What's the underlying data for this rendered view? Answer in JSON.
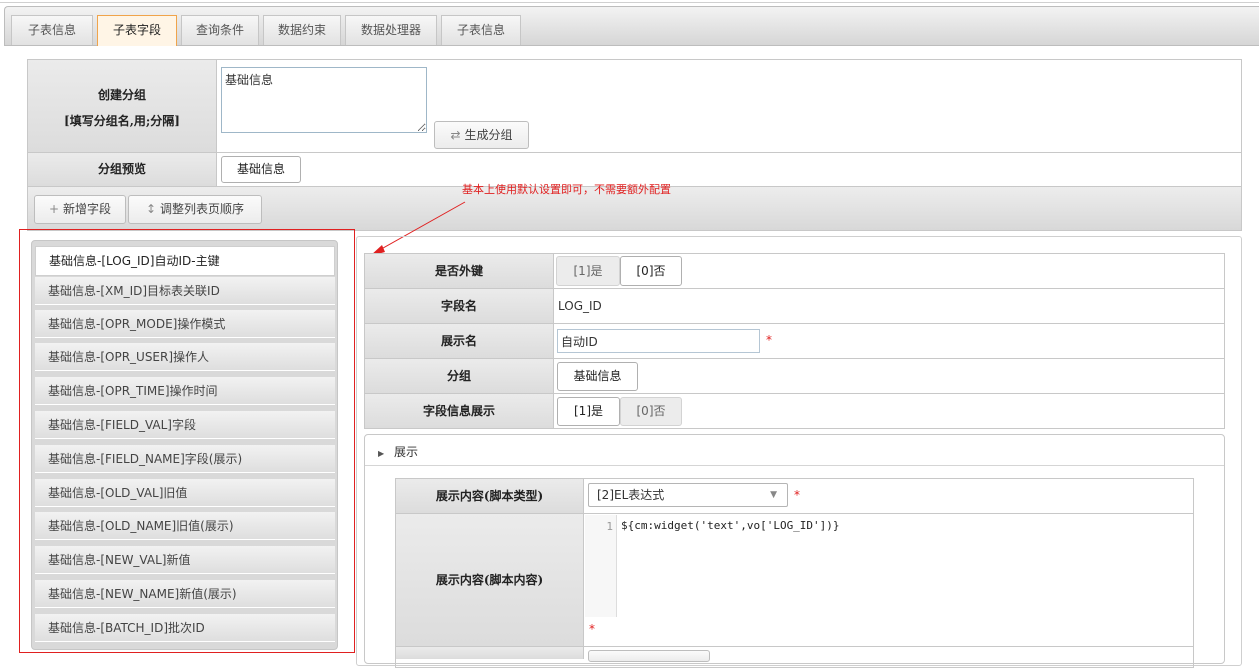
{
  "tabs": [
    {
      "label": "子表信息"
    },
    {
      "label": "子表字段"
    },
    {
      "label": "查询条件"
    },
    {
      "label": "数据约束"
    },
    {
      "label": "数据处理器"
    },
    {
      "label": "子表信息"
    }
  ],
  "group_form": {
    "create_label_line1": "创建分组",
    "create_label_line2": "[填写分组名,用;分隔]",
    "textarea_value": "基础信息",
    "generate_button": "生成分组",
    "preview_label": "分组预览",
    "preview_chip": "基础信息"
  },
  "toolbar": {
    "add_field": "新增字段",
    "reorder": "调整列表页顺序"
  },
  "annotation": "基本上使用默认设置即可，不需要额外配置",
  "field_list": [
    "基础信息-[LOG_ID]自动ID-主键",
    "基础信息-[XM_ID]目标表关联ID",
    "基础信息-[OPR_MODE]操作模式",
    "基础信息-[OPR_USER]操作人",
    "基础信息-[OPR_TIME]操作时间",
    "基础信息-[FIELD_VAL]字段",
    "基础信息-[FIELD_NAME]字段(展示)",
    "基础信息-[OLD_VAL]旧值",
    "基础信息-[OLD_NAME]旧值(展示)",
    "基础信息-[NEW_VAL]新值",
    "基础信息-[NEW_NAME]新值(展示)",
    "基础信息-[BATCH_ID]批次ID"
  ],
  "detail": {
    "foreign_key_label": "是否外键",
    "yes_label": "[1]是",
    "no_label": "[0]否",
    "field_name_label": "字段名",
    "field_name_value": "LOG_ID",
    "display_name_label": "展示名",
    "display_name_value": "自动ID",
    "group_label": "分组",
    "group_value": "基础信息",
    "field_info_label": "字段信息展示",
    "required_mark": "*",
    "display_section": "展示",
    "script_type_label": "展示内容(脚本类型)",
    "script_type_value": "[2]EL表达式",
    "script_content_label": "展示内容(脚本内容)",
    "line_number": "1",
    "code_text": "${cm:widget('text',vo['LOG_ID'])}"
  },
  "colors": {
    "accent": "#f0a44b",
    "annotation": "#e02020"
  }
}
